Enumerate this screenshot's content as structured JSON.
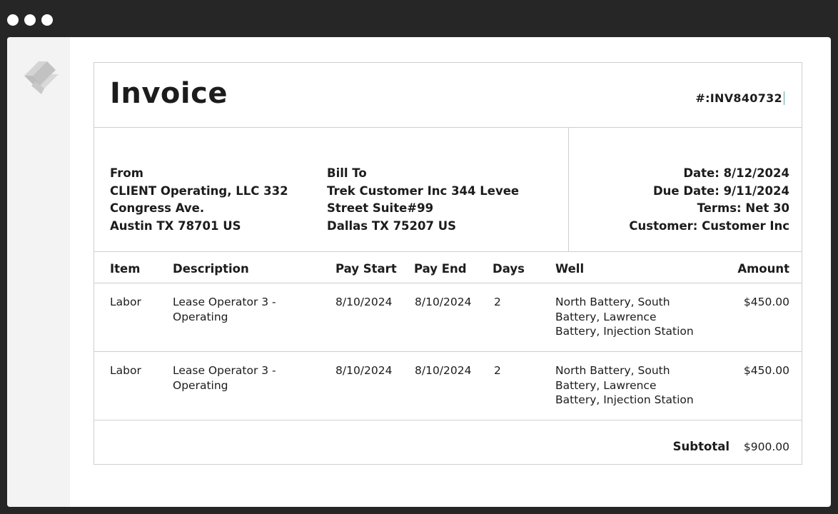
{
  "invoice": {
    "title": "Invoice",
    "number": "#:INV840732"
  },
  "from": {
    "label": "From",
    "line1": "CLIENT Operating, LLC 332",
    "line2": "Congress Ave.",
    "line3": "Austin TX 78701 US"
  },
  "bill_to": {
    "label": "Bill To",
    "line1": "Trek Customer Inc 344 Levee",
    "line2": "Street Suite#99",
    "line3": "Dallas TX 75207 US"
  },
  "meta": {
    "date": "Date: 8/12/2024",
    "due_date": "Due Date: 9/11/2024",
    "terms": "Terms: Net 30",
    "customer": "Customer: Customer Inc"
  },
  "table": {
    "headers": {
      "item": "Item",
      "description": "Description",
      "pay_start": "Pay Start",
      "pay_end": "Pay End",
      "days": "Days",
      "well": "Well",
      "amount": "Amount"
    },
    "rows": [
      {
        "item": "Labor",
        "description_line1": "Lease Operator 3 -",
        "description_line2": "Operating",
        "pay_start": "8/10/2024",
        "pay_end": "8/10/2024",
        "days": "2",
        "well_line1": "North Battery, South",
        "well_line2": "Battery, Lawrence",
        "well_line3": "Battery, Injection Station",
        "amount": "$450.00"
      },
      {
        "item": "Labor",
        "description_line1": "Lease Operator 3 -",
        "description_line2": "Operating",
        "pay_start": "8/10/2024",
        "pay_end": "8/10/2024",
        "days": "2",
        "well_line1": "North Battery, South",
        "well_line2": "Battery, Lawrence",
        "well_line3": "Battery, Injection Station",
        "amount": "$450.00"
      }
    ]
  },
  "subtotal": {
    "label": "Subtotal",
    "value": "$900.00"
  },
  "icons": {
    "window_dots": [
      "window-close-dot",
      "window-minimize-dot",
      "window-maximize-dot"
    ],
    "app_logo": "app-logo-icon"
  }
}
